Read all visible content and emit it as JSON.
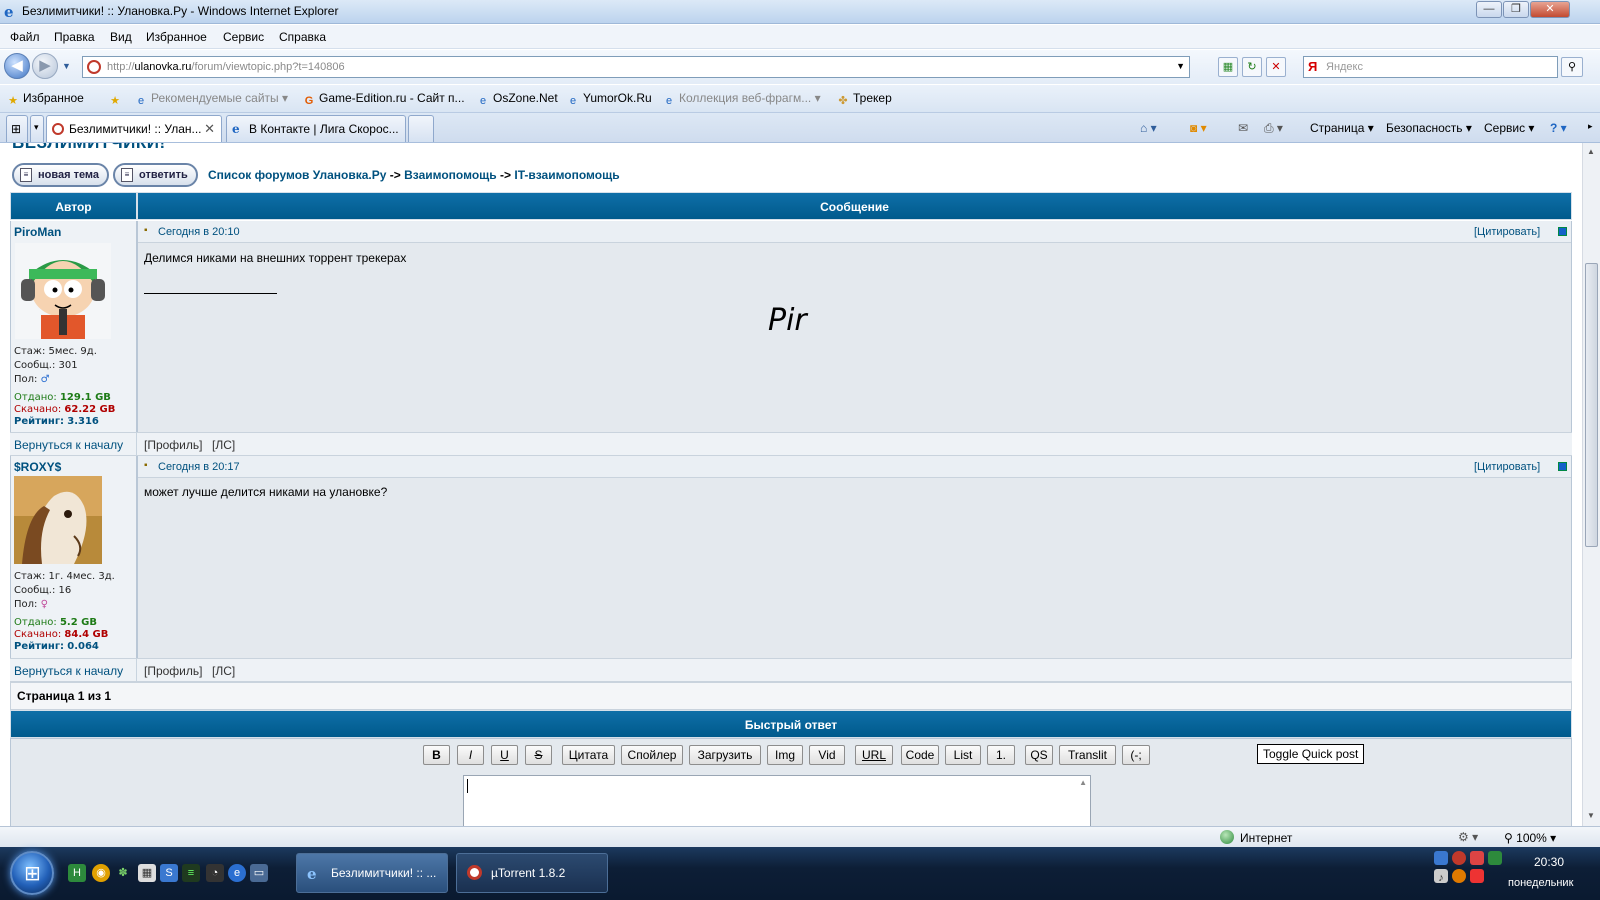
{
  "window": {
    "title": "Безлимитчики! :: Улановка.Ру - Windows Internet Explorer",
    "minimize": "—",
    "maximize": "❐",
    "close": "✕"
  },
  "menu": [
    "Файл",
    "Правка",
    "Вид",
    "Избранное",
    "Сервис",
    "Справка"
  ],
  "address": {
    "url_prefix": "http://",
    "url_host": "ulanovka.ru",
    "url_path": "/forum/viewtopic.php?t=140806",
    "search_placeholder": "Яндекс"
  },
  "favorites": {
    "label": "Избранное",
    "items": [
      "Рекомендуемые сайты",
      "Game-Edition.ru - Сайт п...",
      "OsZone.Net",
      "YumorOk.Ru",
      "Коллекция веб-фрагм...",
      "Трекер"
    ]
  },
  "tabs": [
    "Безлимитчики! :: Улан...",
    "В Контакте | Лига Скорос..."
  ],
  "toolbar_right": [
    "Страница",
    "Безопасность",
    "Сервис"
  ],
  "forum": {
    "title_partial": "БЕЗЛИМИТЧИКИ!",
    "btn_new_topic": "новая тема",
    "btn_reply": "ответить",
    "breadcrumbs": [
      "Список форумов Улановка.Ру",
      "Взаимопомощь",
      "IT-взаимопомощь"
    ],
    "breadcrumb_sep": "->",
    "col_author": "Автор",
    "col_message": "Сообщение",
    "quote_label": "[Цитировать]",
    "back_to_top": "Вернуться к началу",
    "profile_label": "[Профиль]",
    "pm_label": "[ЛС]",
    "labels": {
      "stazh": "Стаж:",
      "posts": "Сообщ.:",
      "gender": "Пол:",
      "given": "Отдано:",
      "downloaded": "Скачано:",
      "rating": "Рейтинг:"
    },
    "posts": [
      {
        "author": "PiroMan",
        "time": "Сегодня в 20:10",
        "stazh": "5мес. 9д.",
        "posts": "301",
        "gender": "♂",
        "given": "129.1 GB",
        "downloaded": "62.22 GB",
        "rating": "3.316",
        "text": "Делимся никами на внешних торрент трекерах",
        "signature": "Pir"
      },
      {
        "author": "$ROXY$",
        "time": "Сегодня в 20:17",
        "stazh": "1г. 4мес. 3д.",
        "posts": "16",
        "gender": "♀",
        "given": "5.2 GB",
        "downloaded": "84.4 GB",
        "rating": "0.064",
        "text": "может лучше делится никами на улановке?",
        "signature": ""
      }
    ],
    "pagination": "Страница 1 из 1",
    "quick_reply_title": "Быстрый ответ",
    "editor_buttons": [
      "B",
      "I",
      "U",
      "S",
      "Цитата",
      "Спойлер",
      "Загрузить",
      "Img",
      "Vid",
      "URL",
      "Code",
      "List",
      "1.",
      "QS",
      "Translit",
      "(-;"
    ],
    "toggle_quick_post": "Toggle Quick post"
  },
  "status": {
    "zone": "Интернет",
    "zoom": "100%"
  },
  "taskbar": {
    "items": [
      "Безлимитчики! :: ...",
      "µTorrent 1.8.2"
    ],
    "time": "20:30",
    "day": "понедельник"
  }
}
